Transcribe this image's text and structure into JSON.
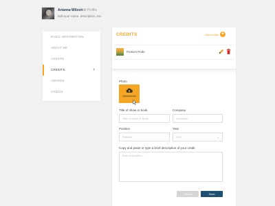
{
  "header": {
    "user_name": "Arianna Wilson",
    "separator": "/",
    "crumb": "Edit Profile",
    "subtitle": "Edit your name, description, etc."
  },
  "sidebar": {
    "items": [
      {
        "label": "BASIC INFORMATION"
      },
      {
        "label": "ABOUT ME"
      },
      {
        "label": "AGENTS"
      },
      {
        "label": "CREDITS",
        "active": true
      },
      {
        "label": "AWARDS"
      },
      {
        "label": "VIDEOS"
      }
    ]
  },
  "credits": {
    "title": "CREDITS",
    "add_label": "Add credits",
    "add_icon": "+",
    "items": [
      {
        "title": "Portia's Pride"
      }
    ]
  },
  "form": {
    "photo_label": "Photo",
    "upload_label": "Upload photo",
    "title_label": "Title of show or book",
    "title_placeholder": "Title of Show or Book",
    "company_label": "Company",
    "company_placeholder": "Company",
    "position_label": "Position",
    "position_placeholder": "Position",
    "year_label": "Year",
    "year_value": "Year",
    "year_arrow": "⌄",
    "description_label": "Copy and paste or type a brief description of your credit",
    "description_placeholder": "Brief description..."
  },
  "actions": {
    "cancel_label": "Cancel",
    "save_label": "Save"
  },
  "colors": {
    "accent": "#f5a623",
    "primary": "#1e4f72",
    "delete": "#d0312d"
  }
}
